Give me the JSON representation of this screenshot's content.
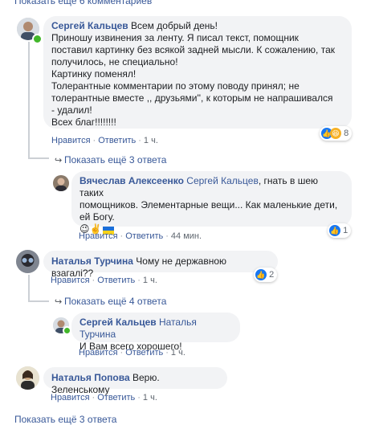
{
  "top_more": "Показать ещё 6 комментариев",
  "c1": {
    "author": "Сергей Кальцев",
    "lines": [
      "Всем добрый день!",
      "Приношу извинения за ленту. Я писал текст, помощник",
      "поставил картинку без всякой задней мысли. К сожалению, так",
      "получилось, не специально!",
      "Картинку поменял!",
      "Толерантные комментарии по этому поводу принял; не",
      "толерантные вместе ,, друзьями'', к которым не напрашивался",
      "- удалил!",
      "Всех благ!!!!!!!!"
    ],
    "reactions": "8",
    "like": "Нравится",
    "reply": "Ответить",
    "time": "1 ч."
  },
  "more1": "Показать ещё 3 ответа",
  "r1": {
    "author": "Вячеслав Алексеенко",
    "mention": "Сергей Кальцев",
    "text1": ", гнать в шею таких",
    "text2": "помощников. Элементарные вещи... Как маленькие дети,",
    "text3": "ей Богу.",
    "emoji": "😉✌️",
    "reactions": "1",
    "like": "Нравится",
    "reply": "Ответить",
    "time": "44 мин."
  },
  "c2": {
    "author": "Наталья Турчина",
    "text": "Чому не державною взагалі??",
    "reactions": "2",
    "like": "Нравится",
    "reply": "Ответить",
    "time": "1 ч."
  },
  "more2": "Показать ещё 4 ответа",
  "r2": {
    "author": "Сергей Кальцев",
    "mention": "Наталья Турчина",
    "text": "И Вам всего хорошего!",
    "like": "Нравится",
    "reply": "Ответить",
    "time": "1 ч."
  },
  "c3": {
    "author": "Наталья Попова",
    "text": "Верю. Зеленському",
    "like": "Нравится",
    "reply": "Ответить",
    "time": "1 ч."
  },
  "bottom_more": "Показать ещё 3 ответа"
}
